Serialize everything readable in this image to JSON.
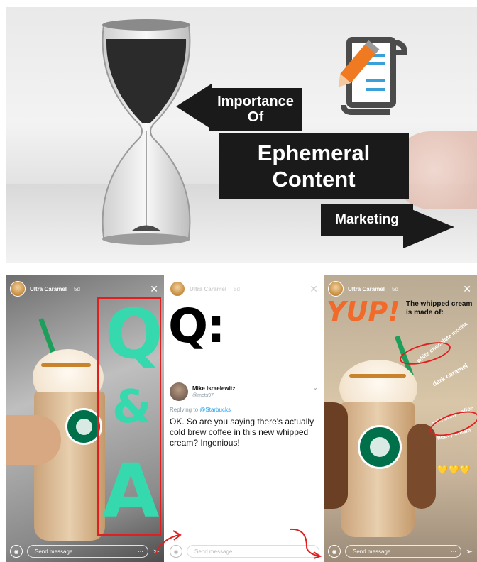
{
  "banner": {
    "line1": "Importance",
    "line2": "Of",
    "line3": "Ephemeral",
    "line4": "Content",
    "line5": "Marketing",
    "icon": "document-pencil-icon",
    "accent": "#f07a22",
    "line_color": "#3aa0d8"
  },
  "stories": [
    {
      "username": "Ultra Caramel",
      "age": "5d",
      "letters": {
        "q": "Q",
        "amp": "&",
        "a": "A"
      },
      "send_placeholder": "Send message",
      "more": "···"
    },
    {
      "username": "Ultra Caramel",
      "age": "5d",
      "big_q": "Q:",
      "tweet": {
        "author": "Mike Israelewitz",
        "handle": "@mets97",
        "replying_prefix": "Replying to",
        "replying_to": "@Starbucks",
        "text": "OK. So are you saying there's actually cold brew coffee in this new whipped cream? Ingenious!"
      },
      "send_placeholder": "Send message"
    },
    {
      "username": "Ultra Caramel",
      "age": "5d",
      "yup": "YUP!",
      "caption": "The whipped cream is made of:",
      "ingredients": [
        "white chocolate mocha",
        "dark caramel",
        "cold brew coffee",
        "heavy cream"
      ],
      "emoji": "💛💛💛",
      "send_placeholder": "Send message",
      "more": "···"
    }
  ],
  "colors": {
    "qa": "#36d9ae",
    "yup": "#f26a2a",
    "highlight": "#e02020",
    "starbucks": "#00704a"
  }
}
